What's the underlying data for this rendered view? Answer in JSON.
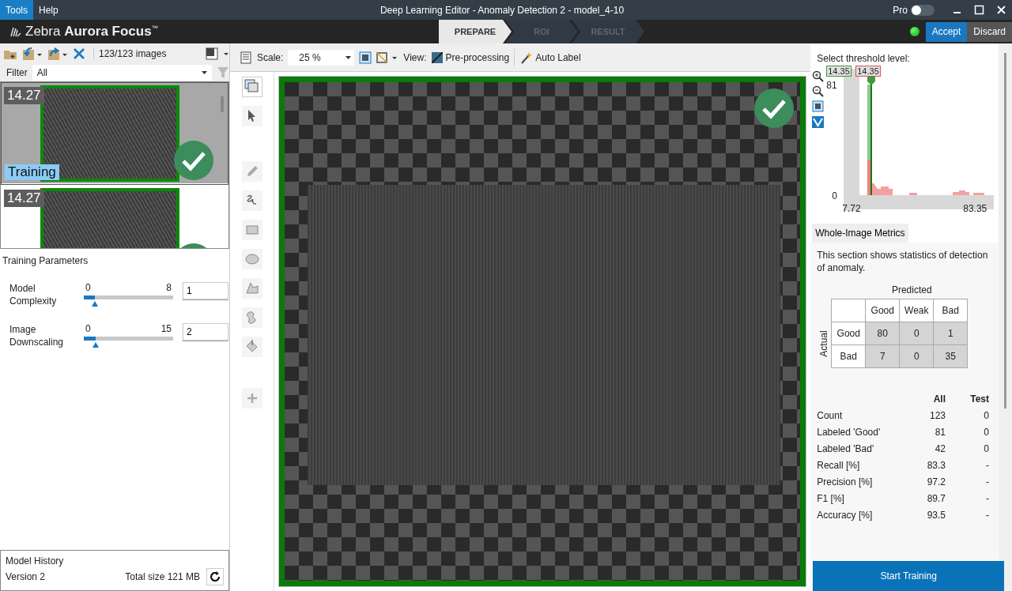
{
  "title_bar": {
    "menu": [
      {
        "label": "Tools",
        "selected": true
      },
      {
        "label": "Help",
        "selected": false
      }
    ],
    "title": "Deep Learning Editor - Anomaly Detection 2 - model_4-10",
    "pro_label": "Pro",
    "pro_on": false
  },
  "header": {
    "logo_light": "Zebra",
    "logo_bold": "Aurora Focus",
    "logo_mark": "™",
    "steps": [
      {
        "label": "PREPARE",
        "selected": true
      },
      {
        "label": "ROI",
        "selected": false
      },
      {
        "label": "RESULT",
        "selected": false
      }
    ],
    "actions": [
      {
        "label": "Accept",
        "kind": "primary"
      },
      {
        "label": "Discard",
        "kind": "secondary"
      }
    ]
  },
  "image_list": {
    "count": "123/123 images",
    "filter_label": "Filter",
    "filter_value": "All",
    "thumbnails": [
      {
        "score": "14.27",
        "tag": "Training",
        "selected": true
      },
      {
        "score": "14.27",
        "selected": false
      }
    ]
  },
  "training_parameters": {
    "title": "Training Parameters",
    "params": [
      {
        "label": "Model Complexity",
        "min": "0",
        "max": "8",
        "level": 0.125,
        "value": "1"
      },
      {
        "label": "Image Downscaling",
        "min": "0",
        "max": "15",
        "level": 0.133,
        "value": "2"
      }
    ]
  },
  "model_history": {
    "title": "Model History",
    "version": "Version 2",
    "total_size": "Total size 121 MB"
  },
  "toolbar": {
    "scale_label": "Scale:",
    "scale_value": "25 %",
    "view_label": "View:",
    "view_value": "Pre-processing",
    "auto_label": "Auto Label"
  },
  "threshold": {
    "title": "Select threshold level:",
    "low_value": "14.35",
    "high_value": "14.35",
    "y_max": "81",
    "y_min": "0",
    "x_min": "7.72",
    "x_max": "83.35"
  },
  "metrics": {
    "tab": "Whole-Image Metrics",
    "description": "This section shows statistics of detection of anomaly.",
    "predicted_label": "Predicted",
    "actual_label": "Actual",
    "matrix_columns": [
      "Good",
      "Weak",
      "Bad"
    ],
    "matrix_rows": [
      {
        "label": "Good",
        "cells": [
          "80",
          "0",
          "1"
        ]
      },
      {
        "label": "Bad",
        "cells": [
          "7",
          "0",
          "35"
        ]
      }
    ],
    "stats_columns": [
      "All",
      "Test"
    ],
    "stats_rows": [
      {
        "label": "Count",
        "values": [
          "123",
          "0"
        ]
      },
      {
        "label": "Labeled 'Good'",
        "values": [
          "81",
          "0"
        ]
      },
      {
        "label": "Labeled 'Bad'",
        "values": [
          "42",
          "0"
        ]
      },
      {
        "label": "Recall [%]",
        "values": [
          "83.3",
          "-"
        ]
      },
      {
        "label": "Precision [%]",
        "values": [
          "97.2",
          "-"
        ]
      },
      {
        "label": "F1 [%]",
        "values": [
          "89.7",
          "-"
        ]
      },
      {
        "label": "Accuracy [%]",
        "values": [
          "93.5",
          "-"
        ]
      }
    ]
  },
  "start_button": "Start Training"
}
